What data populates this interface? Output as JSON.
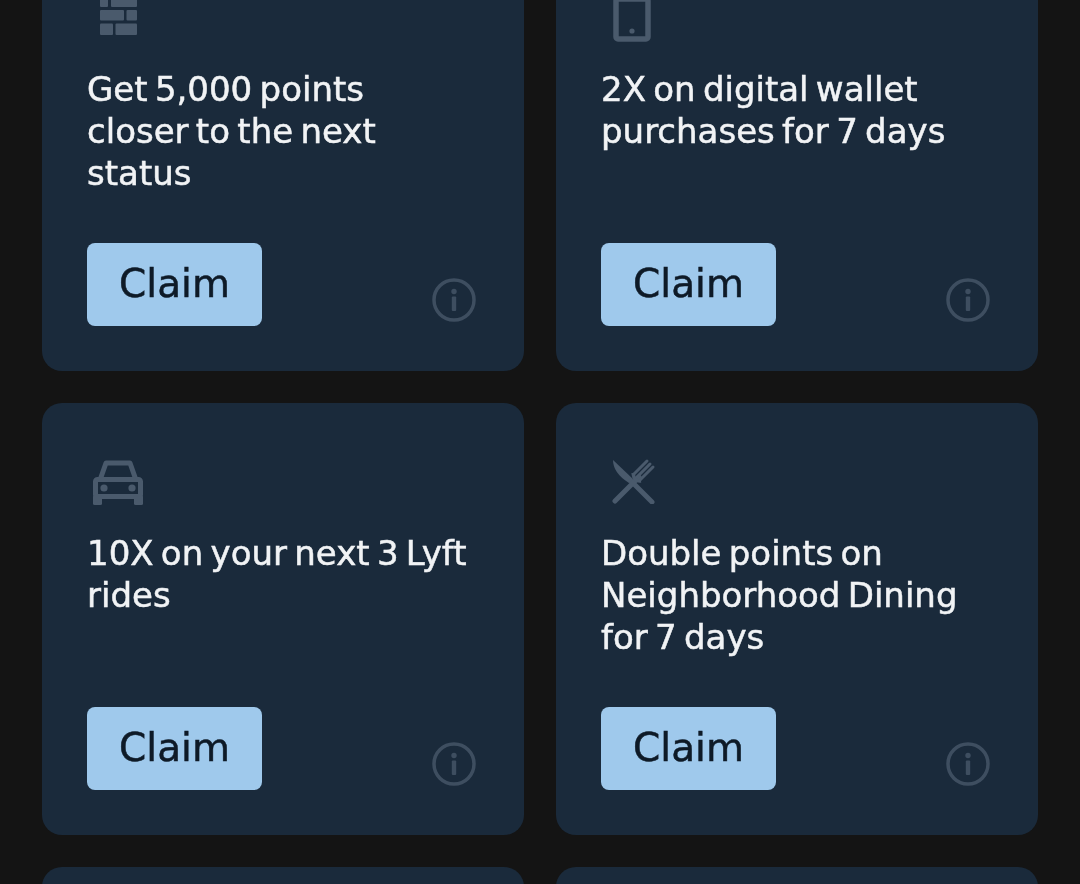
{
  "cards": [
    {
      "kind": "offer",
      "title": "Get 5,000 points closer to the next status",
      "button": "Claim"
    },
    {
      "kind": "offer",
      "title": "2X on digital wallet purchases for 7 days",
      "button": "Claim"
    },
    {
      "kind": "offer",
      "title": "10X on your next 3 Lyft rides",
      "button": "Claim"
    },
    {
      "kind": "offer",
      "title": "Double points on Neighborhood Dining for 7 days",
      "button": "Claim"
    },
    {
      "kind": "cut_off"
    },
    {
      "kind": "cut_off"
    }
  ]
}
